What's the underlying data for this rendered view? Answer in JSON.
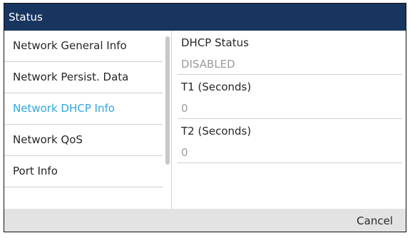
{
  "header": {
    "title": "Status"
  },
  "sidebar": {
    "items": [
      {
        "label": "Network General Info"
      },
      {
        "label": "Network Persist. Data"
      },
      {
        "label": "Network DHCP Info"
      },
      {
        "label": "Network QoS"
      },
      {
        "label": "Port Info"
      }
    ],
    "active_index": 2
  },
  "main": {
    "fields": [
      {
        "label": "DHCP Status",
        "value": "DISABLED"
      },
      {
        "label": "T1 (Seconds)",
        "value": "0"
      },
      {
        "label": "T2 (Seconds)",
        "value": "0"
      }
    ]
  },
  "softkeys": {
    "cancel_label": "Cancel"
  },
  "colors": {
    "title_bar": "#18355f",
    "active_item": "#2ea6e0",
    "softkey_bar": "#e3e3e3"
  }
}
